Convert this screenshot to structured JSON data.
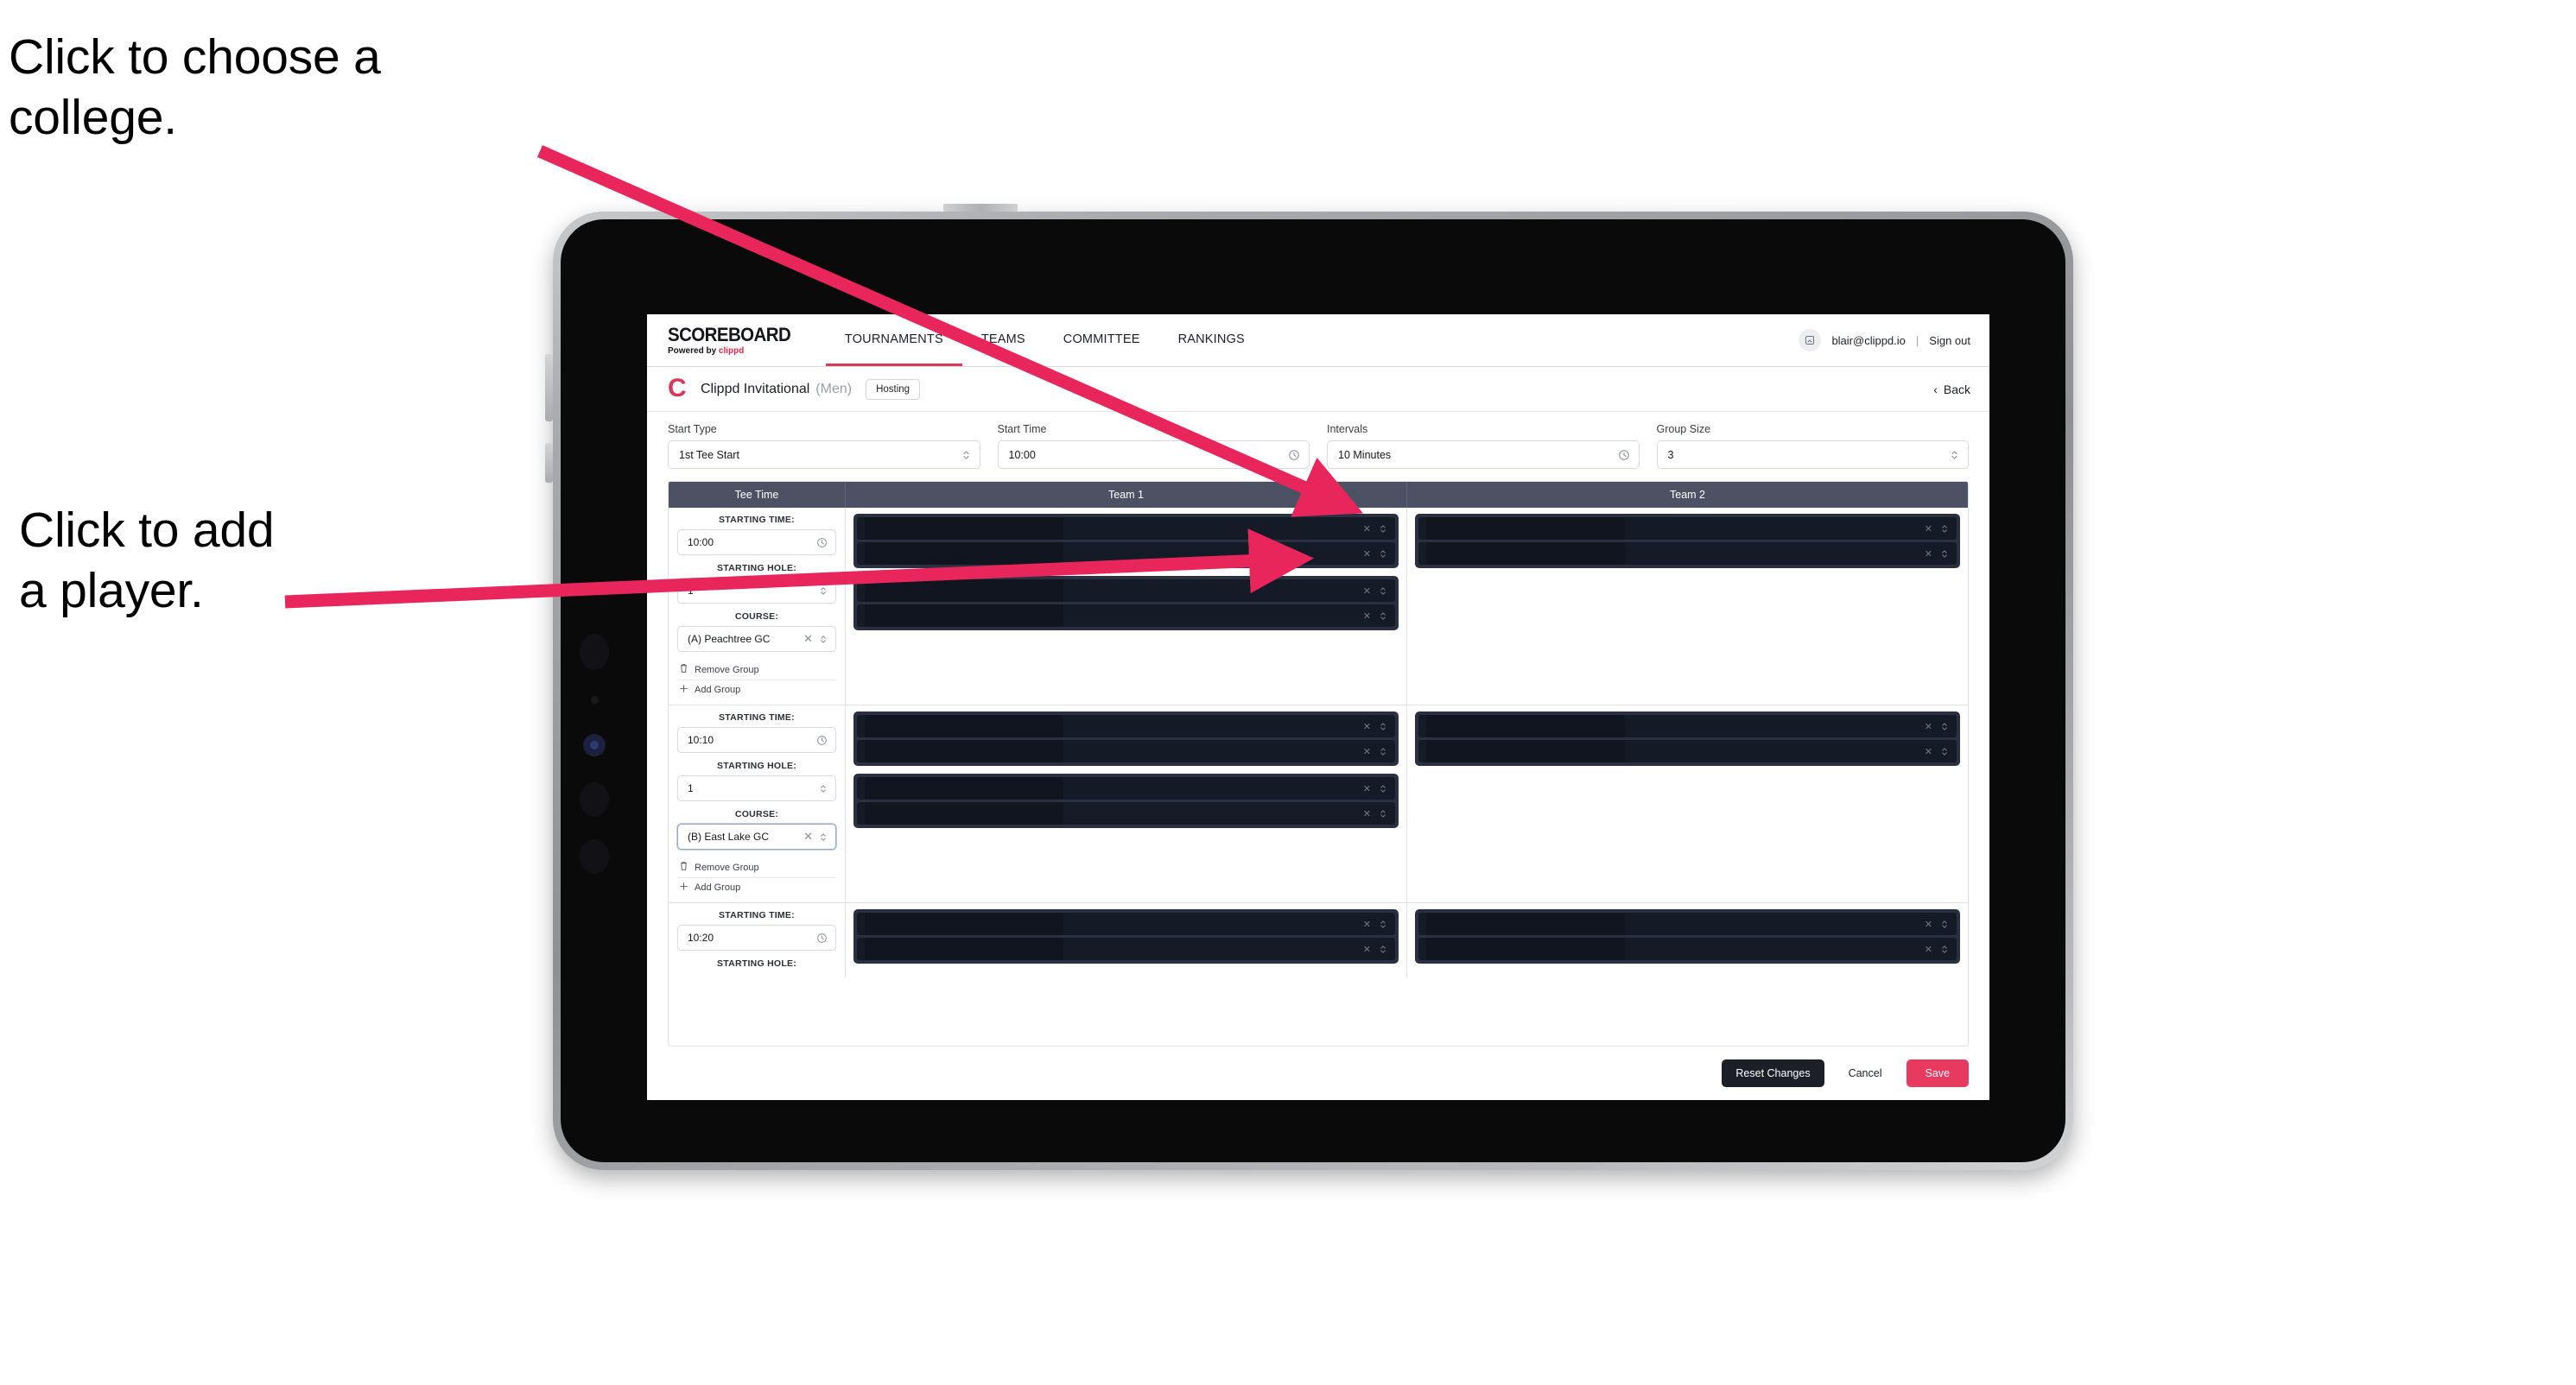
{
  "annotations": [
    {
      "id": "college",
      "text": "Click to choose a\ncollege."
    },
    {
      "id": "player",
      "text": "Click to add\na player."
    }
  ],
  "accent": {
    "arrow": "#e8265c",
    "brand_pink": "#e8264f",
    "save": "#e8395f",
    "tab_underline": "#d93a5c",
    "table_header": "#4c5264"
  },
  "topnav": {
    "brand_title": "SCOREBOARD",
    "brand_sub_prefix": "Powered by ",
    "brand_sub_accent": "clippd",
    "tabs": [
      {
        "label": "TOURNAMENTS",
        "active": true
      },
      {
        "label": "TEAMS",
        "active": false
      },
      {
        "label": "COMMITTEE",
        "active": false
      },
      {
        "label": "RANKINGS",
        "active": false
      }
    ],
    "avatar_icon": "user-avatar-icon",
    "email": "blair@clippd.io",
    "separator": "|",
    "sign_out": "Sign out"
  },
  "subheader": {
    "logo_letter": "C",
    "tournament_name": "Clippd Invitational",
    "gender": "(Men)",
    "badge": "Hosting",
    "back_label": "Back",
    "back_chevron": "‹"
  },
  "controls": [
    {
      "label": "Start Type",
      "value": "1st Tee Start",
      "icon": "stepper-icon"
    },
    {
      "label": "Start Time",
      "value": "10:00",
      "icon": "clock-icon"
    },
    {
      "label": "Intervals",
      "value": "10 Minutes",
      "icon": "clock-icon"
    },
    {
      "label": "Group Size",
      "value": "3",
      "icon": "stepper-icon"
    }
  ],
  "table": {
    "headers": [
      "Tee Time",
      "Team 1",
      "Team 2"
    ],
    "field_labels": {
      "time": "STARTING TIME:",
      "hole": "STARTING HOLE:",
      "course": "COURSE:"
    },
    "group_actions": {
      "remove": "Remove Group",
      "add": "Add Group",
      "remove_icon": "trash-icon",
      "add_icon": "plus-icon"
    },
    "row_icons": {
      "clear": "close-icon",
      "stepper": "stepper-icon"
    },
    "groups": [
      {
        "time": "10:00",
        "hole": "1",
        "course": "(A) Peachtree GC",
        "course_focused": false,
        "team1_cards": [
          {
            "rows": 2
          },
          {
            "rows": 2
          }
        ],
        "team2_cards": [
          {
            "rows": 2
          }
        ]
      },
      {
        "time": "10:10",
        "hole": "1",
        "course": "(B) East Lake GC",
        "course_focused": true,
        "team1_cards": [
          {
            "rows": 2
          },
          {
            "rows": 2
          }
        ],
        "team2_cards": [
          {
            "rows": 2
          }
        ]
      },
      {
        "time": "10:20",
        "hole": "",
        "course": "",
        "course_focused": false,
        "partial": true,
        "team1_cards": [
          {
            "rows": 2
          }
        ],
        "team2_cards": [
          {
            "rows": 2
          }
        ]
      }
    ]
  },
  "footer": {
    "reset": "Reset Changes",
    "cancel": "Cancel",
    "save": "Save"
  }
}
